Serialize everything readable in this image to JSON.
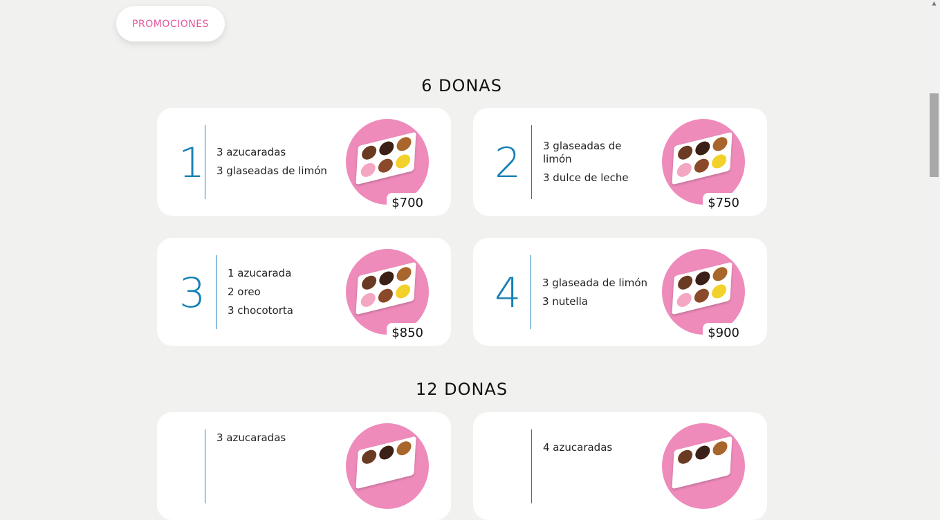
{
  "promo_button": {
    "label": "PROMOCIONES"
  },
  "sections": [
    {
      "title": "6 DONAS"
    },
    {
      "title": "12 DONAS"
    }
  ],
  "cards": [
    {
      "number": "1",
      "items": [
        "3 azucaradas",
        "3 glaseadas de limón"
      ],
      "price": "$700"
    },
    {
      "number": "2",
      "items": [
        "3 glaseadas de limón",
        "3 dulce de leche"
      ],
      "price": "$750"
    },
    {
      "number": "3",
      "items": [
        "1 azucarada",
        "2 oreo",
        "3 chocotorta"
      ],
      "price": "$850"
    },
    {
      "number": "4",
      "items": [
        "3 glaseada de limón",
        "3 nutella"
      ],
      "price": "$900"
    },
    {
      "items": [
        "3 azucaradas"
      ]
    },
    {
      "items": [
        "4 azucaradas"
      ]
    }
  ],
  "colors": {
    "accent_blue": "#1580b5",
    "pink": "#ee8bbb",
    "promo_text": "#e0559b",
    "background": "#f1f1f0"
  },
  "icons": {
    "donut_box_image": "donut-box-image"
  }
}
